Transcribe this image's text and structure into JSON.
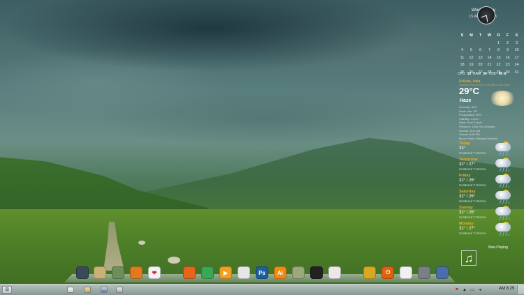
{
  "calendar_widget": {
    "weekday": "Wednesday",
    "date": "15 August, 2013",
    "headers": [
      "S",
      "M",
      "T",
      "W",
      "R",
      "F",
      "S"
    ],
    "weeks": [
      [
        "",
        "",
        "",
        "1",
        "2",
        "3"
      ],
      [
        "4",
        "5",
        "6",
        "7",
        "8",
        "9",
        "10"
      ],
      [
        "11",
        "12",
        "13",
        "14",
        "15",
        "16",
        "17"
      ],
      [
        "18",
        "19",
        "20",
        "21",
        "22",
        "23",
        "24"
      ],
      [
        "25",
        "26",
        "27",
        "28",
        "29",
        "30",
        "31"
      ]
    ]
  },
  "system_stats": {
    "cpu_label": "CPU",
    "cpu_value": "10",
    "ram_label": "RAM",
    "ram_value": "34",
    "hdd_label": "HDD",
    "hdd_value": "66 G"
  },
  "weather": {
    "location": "Kolkata, India",
    "updated": "Updated 08/15/2013 8:29 AM Local Time",
    "temperature": "29°C",
    "condition": "Haze",
    "details": [
      "Humidity: 84%",
      "Feels Like: 35°",
      "Precipitation: 60%",
      "Visibility: 4.8 km",
      "Wind: W at 9 km/h",
      "Pressure: 1000 hPa (Steady)",
      "Sunrise: 5:11 AM",
      "Sunset: 6:08 PM",
      "Moon Phase: Waxing Crescent"
    ],
    "forecast": [
      {
        "day": "Today",
        "temp": "33°",
        "desc": "Scattered T-Storms"
      },
      {
        "day": "Tomorrow",
        "temp": "32° / 27°",
        "desc": "Scattered T-Storms"
      },
      {
        "day": "Friday",
        "temp": "32° / 26°",
        "desc": "Scattered T-Storms"
      },
      {
        "day": "Saturday",
        "temp": "32° / 26°",
        "desc": "Scattered T-Storms"
      },
      {
        "day": "Sunday",
        "temp": "32° / 26°",
        "desc": "Scattered T-Storms"
      },
      {
        "day": "Monday",
        "temp": "32° / 27°",
        "desc": "Scattered T-Storms"
      }
    ]
  },
  "now_playing": {
    "label": "Now Playing",
    "icon": "music-note-icon",
    "glyph": "♫"
  },
  "dock": {
    "items": [
      {
        "name": "my-computer-icon",
        "glyph": "",
        "color": "#3a4a5a"
      },
      {
        "name": "documents-folder-icon",
        "glyph": "",
        "color": "#c9b27a"
      },
      {
        "name": "pictures-icon",
        "glyph": "",
        "color": "#6d8f5a"
      },
      {
        "name": "music-icon",
        "glyph": "",
        "color": "#e07a20"
      },
      {
        "name": "favorites-icon",
        "glyph": "❤",
        "color": "#f2f2f2"
      },
      {
        "name": "firefox-icon",
        "glyph": "",
        "color": "#e8641a"
      },
      {
        "name": "chrome-icon",
        "glyph": "",
        "color": "#3aa757"
      },
      {
        "name": "media-player-icon",
        "glyph": "▶",
        "color": "#f0a020"
      },
      {
        "name": "app-circle-icon",
        "glyph": "",
        "color": "#e6e6e6"
      },
      {
        "name": "photoshop-icon",
        "glyph": "Ps",
        "color": "#1c5e9e"
      },
      {
        "name": "illustrator-icon",
        "glyph": "Ai",
        "color": "#f08a10"
      },
      {
        "name": "network-icon",
        "glyph": "",
        "color": "#9ba87a"
      },
      {
        "name": "terminal-icon",
        "glyph": "",
        "color": "#222222"
      },
      {
        "name": "blank-app-icon",
        "glyph": "",
        "color": "#e9e9e9"
      },
      {
        "name": "settings-icon",
        "glyph": "",
        "color": "#d8a820"
      },
      {
        "name": "power-icon",
        "glyph": "⏻",
        "color": "#e06010"
      },
      {
        "name": "media-center-icon",
        "glyph": "",
        "color": "#f0f0f0"
      },
      {
        "name": "recycle-bin-icon",
        "glyph": "",
        "color": "#7a7f84"
      },
      {
        "name": "task-manager-icon",
        "glyph": "",
        "color": "#4a6ea8"
      }
    ]
  },
  "taskbar": {
    "start_icon": "windows-orb-icon",
    "time": "AM 8:29"
  }
}
